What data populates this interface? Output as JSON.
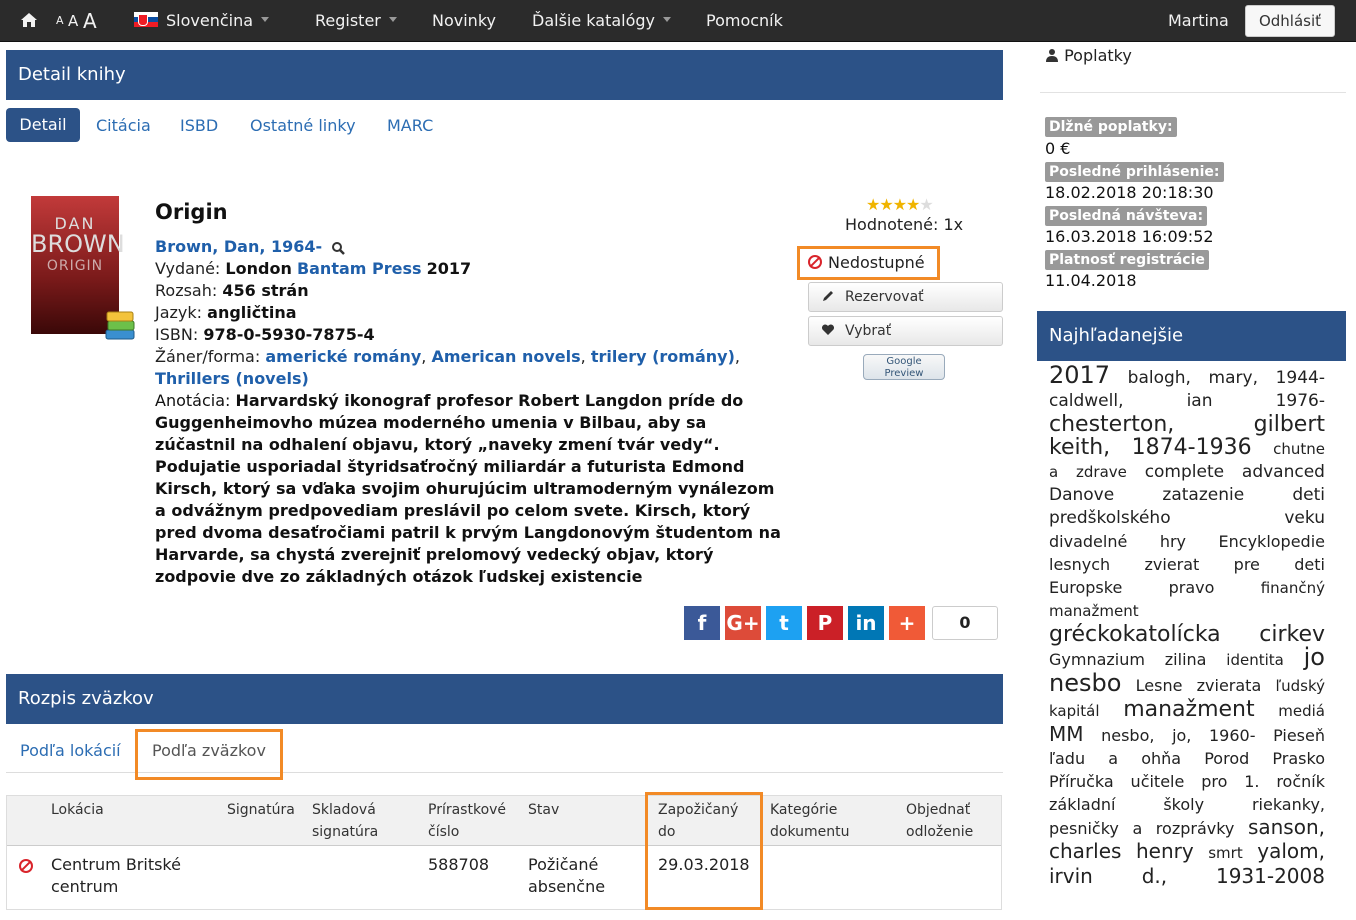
{
  "nav": {
    "home_icon": "home-icon",
    "font_sizes": [
      "A",
      "A",
      "A"
    ],
    "language": "Slovenčina",
    "register": "Register",
    "news": "Novinky",
    "catalogs": "Ďalšie katalógy",
    "helper": "Pomocník",
    "user": "Martina",
    "logout": "Odhlásiť"
  },
  "detail": {
    "heading": "Detail knihy",
    "tabs": [
      "Detail",
      "Citácia",
      "ISBD",
      "Ostatné linky",
      "MARC"
    ],
    "cover_author": "DAN",
    "cover_surname": "BROWN",
    "cover_title": "ORIGIN",
    "title": "Origin",
    "author": "Brown, Dan, 1964-",
    "published_label": "Vydané:",
    "published_place": "London",
    "publisher": "Bantam Press",
    "published_year": "2017",
    "extent_label": "Rozsah:",
    "extent": "456 strán",
    "language_label": "Jazyk:",
    "language": "angličtina",
    "isbn_label": "ISBN:",
    "isbn": "978-0-5930-7875-4",
    "genre_label": "Žáner/forma:",
    "genres": [
      "americké romány",
      "American novels",
      "trilery (romány)",
      "Thrillers (novels)"
    ],
    "annotation_label": "Anotácia:",
    "annotation_lines": [
      "Harvardský ikonograf profesor Robert Langdon príde do",
      "Guggenheimovho múzea moderného umenia v Bilbau, aby sa",
      "zúčastnil na odhalení objavu, ktorý „naveky zmení tvár vedy“.",
      "Podujatie usporiadal štyridsaťročný miliardár a futurista Edmond",
      "Kirsch, ktorý sa vďaka svojim ohurujúcim ultramoderným vynálezom",
      "a odvážnym predpovediam preslávil po celom svete. Kirsch, ktorý",
      "pred dvoma desaťročiami patril k prvým Langdonovým študentom na",
      "Harvarde, sa chystá zverejniť prelomový vedecký objav, ktorý",
      "zodpovie dve zo základných otázok ľudskej existencie"
    ],
    "rating_stars": 4,
    "rating_max": 5,
    "rated": "Hodnotené: 1x",
    "status": "Nedostupné",
    "reserve": "Rezervovať",
    "select": "Vybrať",
    "google_preview": [
      "Google",
      "Preview"
    ],
    "share_icons": [
      "facebook-icon",
      "googleplus-icon",
      "twitter-icon",
      "pinterest-icon",
      "linkedin-icon",
      "more-share-icon"
    ],
    "share_glyphs": [
      "f",
      "G+",
      "t",
      "P",
      "in",
      "+"
    ],
    "share_count": "0"
  },
  "volumes": {
    "heading": "Rozpis zväzkov",
    "tabs": [
      "Podľa lokácií",
      "Podľa zväzkov"
    ],
    "columns": [
      [
        "",
        "Lokácia"
      ],
      [
        "",
        "Signatúra"
      ],
      [
        "Skladová",
        "signatúra"
      ],
      [
        "Prírastkové",
        "číslo"
      ],
      [
        "",
        "Stav"
      ],
      [
        "Zapožičaný",
        "do"
      ],
      [
        "Kategórie",
        "dokumentu"
      ],
      [
        "Objednať",
        "odloženie"
      ]
    ],
    "rows": [
      {
        "location": [
          "Centrum Britské",
          "centrum"
        ],
        "signature": "",
        "storage": "",
        "accession": "588708",
        "status": [
          "Požičané",
          "absenčne"
        ],
        "due": "29.03.2018",
        "category": "",
        "order": ""
      }
    ]
  },
  "sidebar": {
    "fees": "Poplatky",
    "debt_label": "Dlžné poplatky:",
    "debt": "0 €",
    "last_login_label": "Posledné prihlásenie:",
    "last_login": "18.02.2018 20:18:30",
    "last_visit_label": "Posledná návšteva:",
    "last_visit": "16.03.2018 16:09:52",
    "registration_label": "Platnosť registrácie",
    "registration": "11.04.2018",
    "top_heading": "Najhľadanejšie",
    "tag_lines": [
      [
        [
          "2017",
          24
        ],
        [
          "balogh,",
          17
        ],
        [
          "mary,",
          17
        ],
        [
          "1944-",
          17
        ]
      ],
      [
        [
          "caldwell,",
          17
        ],
        [
          "ian",
          17
        ],
        [
          "1976-",
          17
        ]
      ],
      [
        [
          "chesterton,",
          22
        ],
        [
          "gilbert",
          22
        ]
      ],
      [
        [
          "keith,",
          22
        ],
        [
          "1874-1936",
          22
        ],
        [
          "chutne",
          15
        ]
      ],
      [
        [
          "a",
          15
        ],
        [
          "zdrave",
          15
        ],
        [
          "complete",
          17
        ],
        [
          "advanced",
          17
        ]
      ],
      [
        [
          "Danove",
          17
        ],
        [
          "zatazenie",
          17
        ],
        [
          "deti",
          17
        ]
      ],
      [
        [
          "predškolského",
          17
        ],
        [
          "veku",
          17
        ]
      ],
      [
        [
          "divadelné",
          16
        ],
        [
          "hry",
          16
        ],
        [
          "Encyklopedie",
          16
        ]
      ],
      [
        [
          "lesnych",
          16
        ],
        [
          "zvierat",
          16
        ],
        [
          "pre",
          16
        ],
        [
          "deti",
          16
        ]
      ],
      [
        [
          "Europske",
          16
        ],
        [
          "pravo",
          16
        ],
        [
          "finančný",
          15
        ]
      ],
      [
        [
          "manažment",
          15
        ]
      ],
      [
        [
          "gréckokatolícka",
          22
        ],
        [
          "cirkev",
          22
        ]
      ],
      [
        [
          "Gymnazium",
          16
        ],
        [
          "zilina",
          16
        ],
        [
          "identita",
          15
        ],
        [
          "jo",
          24
        ]
      ],
      [
        [
          "nesbo",
          24
        ],
        [
          "Lesne",
          16
        ],
        [
          "zvierata",
          16
        ],
        [
          "ľudský",
          15
        ]
      ],
      [
        [
          "kapitál",
          15
        ],
        [
          "manažment",
          22
        ],
        [
          "mediá",
          15
        ]
      ],
      [
        [
          "MM",
          20
        ],
        [
          "nesbo,",
          16
        ],
        [
          "jo,",
          16
        ],
        [
          "1960-",
          16
        ],
        [
          "Pieseň",
          16
        ]
      ],
      [
        [
          "ľadu",
          16
        ],
        [
          "a",
          16
        ],
        [
          "ohňa",
          16
        ],
        [
          "Porod",
          16
        ],
        [
          "Prasko",
          16
        ]
      ],
      [
        [
          "Příručka",
          16
        ],
        [
          "učitele",
          16
        ],
        [
          "pro",
          16
        ],
        [
          "1.",
          16
        ],
        [
          "ročník",
          16
        ]
      ],
      [
        [
          "základní",
          16
        ],
        [
          "školy",
          16
        ],
        [
          "riekanky,",
          16
        ]
      ],
      [
        [
          "pesničky",
          16
        ],
        [
          "a",
          16
        ],
        [
          "rozprávky",
          16
        ],
        [
          "sanson,",
          20
        ]
      ],
      [
        [
          "charles",
          20
        ],
        [
          "henry",
          20
        ],
        [
          "smrt",
          15
        ],
        [
          "yalom,",
          20
        ]
      ],
      [
        [
          "irvin",
          20
        ],
        [
          "d.,",
          20
        ],
        [
          "1931-2008",
          20
        ]
      ]
    ]
  },
  "colors": {
    "navbar": "#2b2b2b",
    "panel_header": "#2c5287",
    "link": "#1f5faa",
    "highlight": "#f28a26",
    "unavailable": "#d9242b",
    "facebook": "#3b5998",
    "googleplus": "#dd4b39",
    "twitter": "#1da1f2",
    "pinterest": "#cb2027",
    "linkedin": "#0077b5",
    "more": "#f05a37"
  }
}
